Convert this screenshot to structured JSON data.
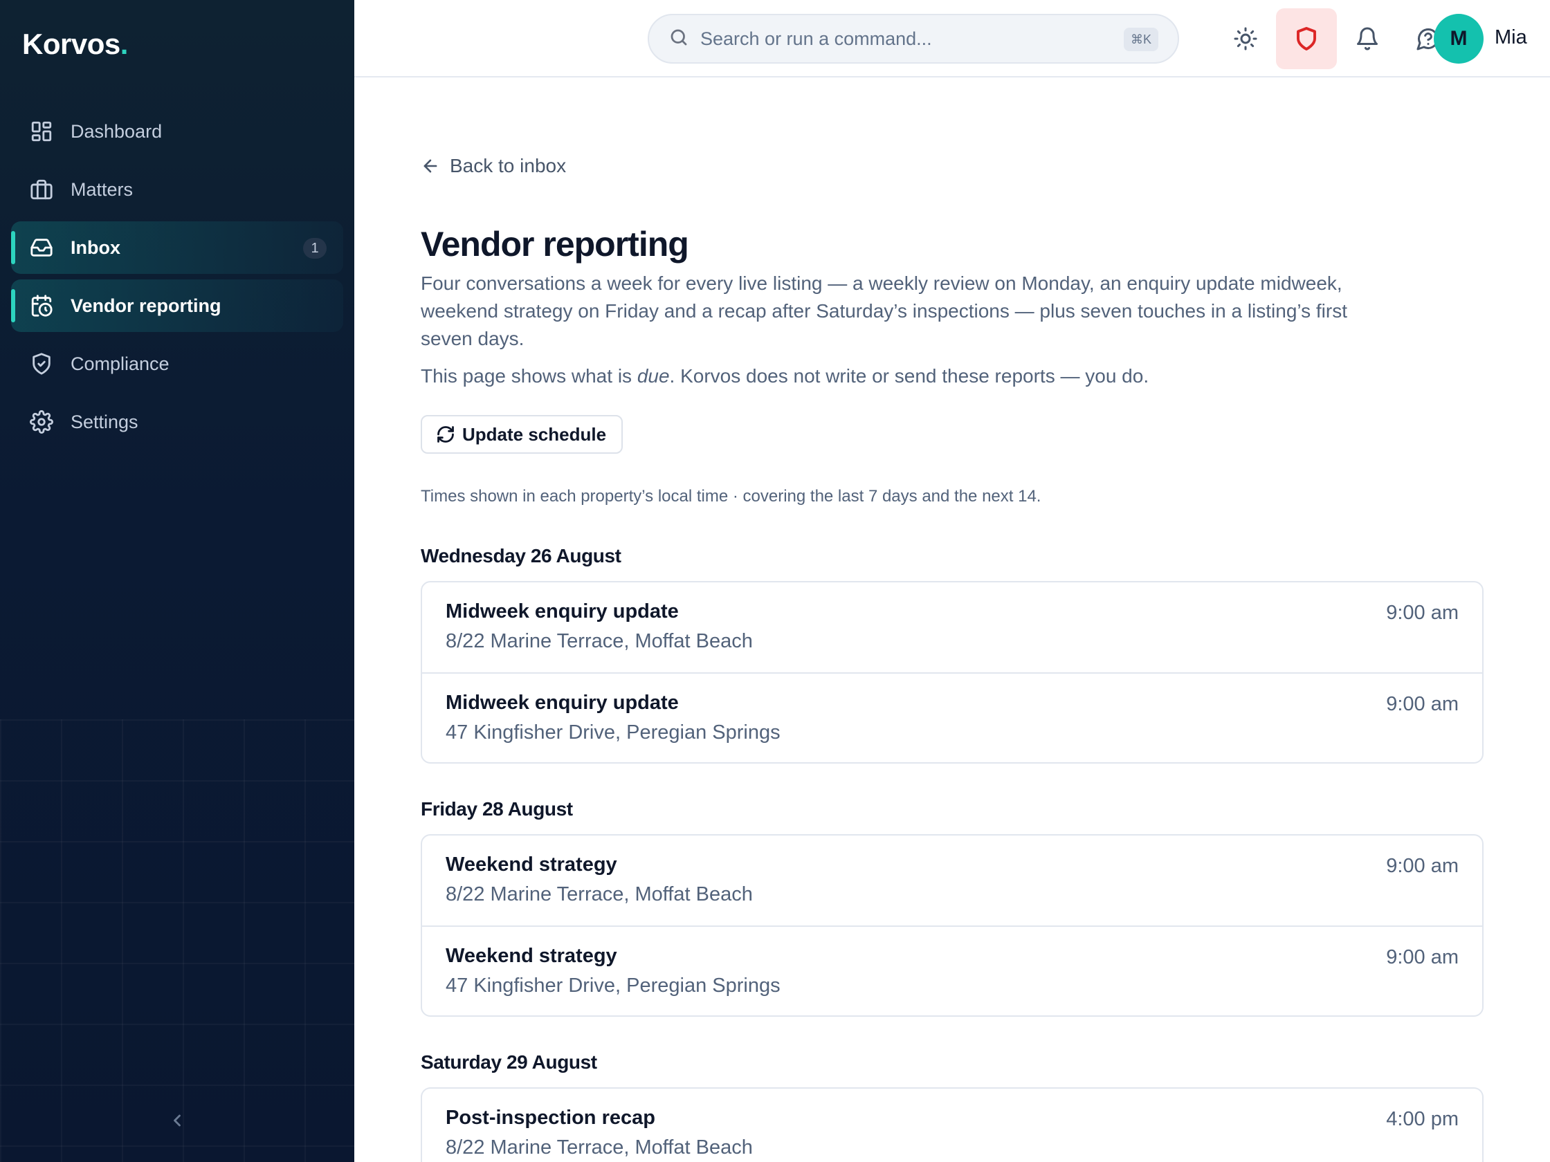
{
  "app": {
    "name": "Korvos",
    "dot": "."
  },
  "sidebar": {
    "items": [
      {
        "label": "Dashboard",
        "icon": "dashboard-icon"
      },
      {
        "label": "Matters",
        "icon": "briefcase-icon"
      },
      {
        "label": "Inbox",
        "icon": "inbox-icon",
        "badge": "1"
      },
      {
        "label": "Vendor reporting",
        "icon": "calendar-clock-icon",
        "active": true
      },
      {
        "label": "Compliance",
        "icon": "shield-check-icon"
      },
      {
        "label": "Settings",
        "icon": "gear-icon"
      }
    ]
  },
  "header": {
    "search_placeholder": "Search or run a command...",
    "search_shortcut": "⌘K",
    "user_initial": "M",
    "user_name": "Mia"
  },
  "page": {
    "back_label": "Back to inbox",
    "title": "Vendor reporting",
    "description": "Four conversations a week for every live listing — a weekly review on Monday, an enquiry update midweek, weekend strategy on Friday and a recap after Saturday’s inspections — plus seven touches in a listing’s first seven days.",
    "note_before": "This page shows what is ",
    "note_em": "due",
    "note_after": ". Korvos does not write or send these reports — you do.",
    "update_button": "Update schedule",
    "meta": "Times shown in each property’s local time · covering the last 7 days and the next 14."
  },
  "schedule": [
    {
      "day": "Wednesday 26 August",
      "items": [
        {
          "title": "Midweek enquiry update",
          "address": "8/22 Marine Terrace, Moffat Beach",
          "time": "9:00 am"
        },
        {
          "title": "Midweek enquiry update",
          "address": "47 Kingfisher Drive, Peregian Springs",
          "time": "9:00 am"
        }
      ]
    },
    {
      "day": "Friday 28 August",
      "items": [
        {
          "title": "Weekend strategy",
          "address": "8/22 Marine Terrace, Moffat Beach",
          "time": "9:00 am"
        },
        {
          "title": "Weekend strategy",
          "address": "47 Kingfisher Drive, Peregian Springs",
          "time": "9:00 am"
        }
      ]
    },
    {
      "day": "Saturday 29 August",
      "items": [
        {
          "title": "Post-inspection recap",
          "address": "8/22 Marine Terrace, Moffat Beach",
          "time": "4:00 pm"
        }
      ]
    }
  ],
  "colors": {
    "accent": "#2dd4bf",
    "sidebar_bg": "#0b1a33",
    "avatar": "#14c1ae",
    "danger": "#dc2626"
  }
}
